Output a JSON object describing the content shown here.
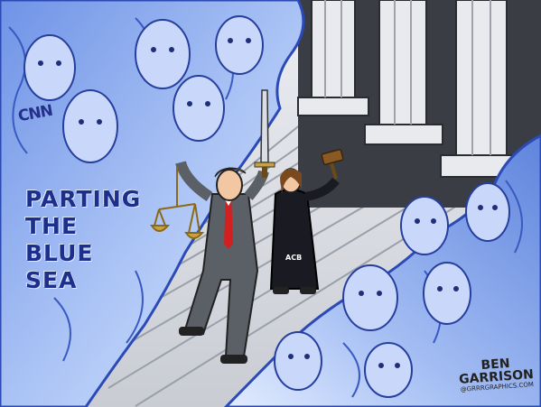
{
  "caption": {
    "lines": [
      "PARTING",
      "THE",
      "BLUE",
      "SEA"
    ]
  },
  "labels": {
    "network_logo": "CNN",
    "robe_text": "ACB"
  },
  "signature": {
    "first": "BEN",
    "last": "GARRISON",
    "site": "@GRRRGRAPHICS.COM"
  },
  "colors": {
    "wave_light": "#dbe7ff",
    "wave_mid": "#8fb0f2",
    "wave_dark": "#3c5fc8",
    "caption_text": "#1d2f8a",
    "suit": "#5b5f66",
    "tie": "#d21f1f",
    "robe": "#1a1a22",
    "hair": "#f0b030",
    "scale_gold": "#c9a23a"
  },
  "scene_elements": [
    "parted-wave-left",
    "parted-wave-right",
    "courthouse-columns",
    "stone-steps",
    "president-figure",
    "judge-figure",
    "gavel",
    "scales-of-justice",
    "raised-sword",
    "faces-in-wave"
  ]
}
